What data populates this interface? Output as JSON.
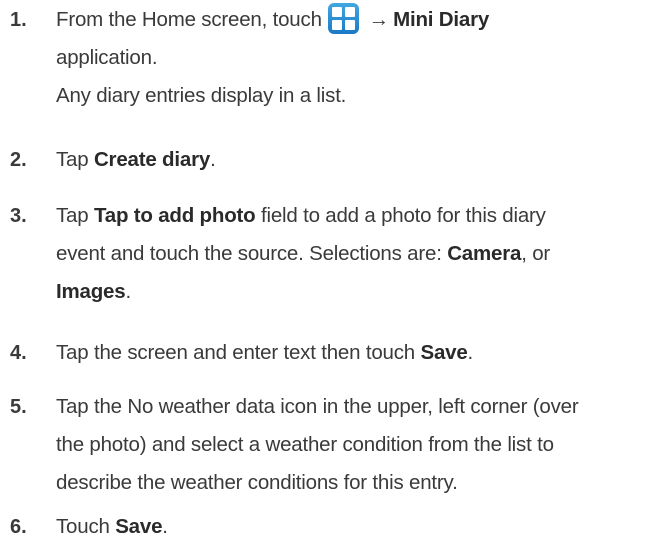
{
  "steps": [
    {
      "num": "1.",
      "line1_a": "From the Home screen, touch",
      "arrow": "→",
      "mini_diary": "Mini Diary",
      "line2": "application.",
      "line3": "Any diary entries display in a list.",
      "icon": "apps-icon"
    },
    {
      "num": "2.",
      "a": "Tap ",
      "b": "Create diary",
      "c": "."
    },
    {
      "num": "3.",
      "a": "Tap ",
      "b": "Tap to add photo",
      "c": " field to add a photo for this diary",
      "d": "event and touch the source. Selections are: ",
      "e": "Camera",
      "f": ", or",
      "g": "Images",
      "h": "."
    },
    {
      "num": "4.",
      "a": "Tap the screen and enter text then touch ",
      "b": "Save",
      "c": "."
    },
    {
      "num": "5.",
      "a": "Tap the No weather data icon in the upper, left corner (over",
      "b": "the photo) and select a weather condition from the list to",
      "c": "describe the weather conditions for this entry."
    },
    {
      "num": "6.",
      "a": "Touch ",
      "b": "Save",
      "c": "."
    }
  ]
}
